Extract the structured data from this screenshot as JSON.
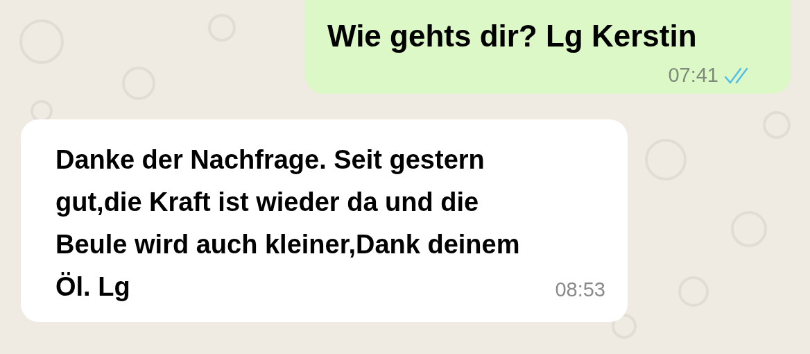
{
  "messages": [
    {
      "kind": "outgoing",
      "text": "Wie gehts dir? Lg Kerstin",
      "time": "07:41",
      "read": true
    },
    {
      "kind": "incoming",
      "text": "Danke der Nachfrage. Seit gestern gut,die Kraft ist wieder da und die Beule wird auch kleiner,Dank deinem Öl. Lg",
      "time": "08:53"
    }
  ]
}
